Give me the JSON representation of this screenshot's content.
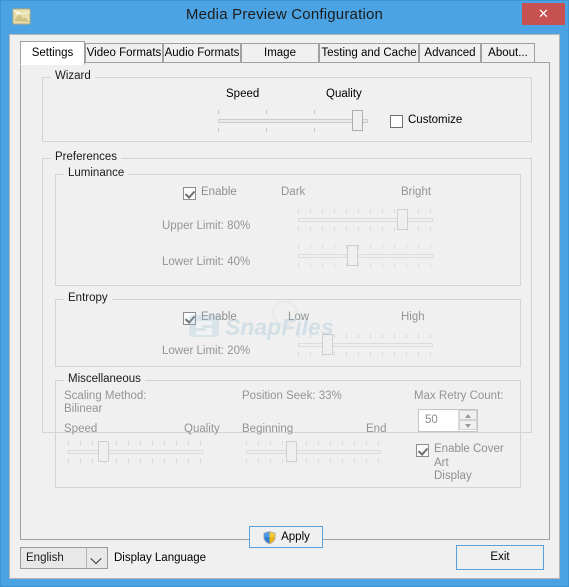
{
  "window": {
    "title": "Media Preview Configuration",
    "icon": "media-preview-app-icon",
    "close_label": "✕",
    "frame_color": "#4ba3e3",
    "close_color": "#c75050"
  },
  "tabs": [
    {
      "label": "Settings",
      "active": true
    },
    {
      "label": "Video Formats",
      "active": false
    },
    {
      "label": "Audio Formats",
      "active": false
    },
    {
      "label": "Image Formats",
      "active": false
    },
    {
      "label": "Testing and Cache",
      "active": false
    },
    {
      "label": "Advanced",
      "active": false
    },
    {
      "label": "About...",
      "active": false
    }
  ],
  "wizard": {
    "group_label": "Wizard",
    "left_label": "Speed",
    "right_label": "Quality",
    "slider_value_pct": 93,
    "customize": {
      "label": "Customize",
      "checked": false,
      "enabled": true
    }
  },
  "preferences": {
    "group_label": "Preferences",
    "luminance": {
      "group_label": "Luminance",
      "enable": {
        "label": "Enable",
        "checked": true,
        "enabled": false
      },
      "left_label": "Dark",
      "right_label": "Bright",
      "upper": {
        "label": "Upper Limit: 80%",
        "value_pct": 80
      },
      "lower": {
        "label": "Lower Limit: 40%",
        "value_pct": 40
      }
    },
    "entropy": {
      "group_label": "Entropy",
      "enable": {
        "label": "Enable",
        "checked": true,
        "enabled": false
      },
      "left_label": "Low",
      "right_label": "High",
      "lower": {
        "label": "Lower Limit: 20%",
        "value_pct": 20
      }
    },
    "miscellaneous": {
      "group_label": "Miscellaneous",
      "scaling_method_label": "Scaling Method:",
      "scaling_method_value": "Bilinear",
      "scaling_left_label": "Speed",
      "scaling_right_label": "Quality",
      "scaling_value_pct": 25,
      "position_seek_label": "Position Seek: 33%",
      "position_left_label": "Beginning",
      "position_right_label": "End",
      "position_value_pct": 33,
      "max_retry_label": "Max Retry Count:",
      "max_retry_value": "50",
      "cover_art": {
        "label_line1": "Enable Cover Art",
        "label_line2": "Display",
        "checked": true,
        "enabled": false
      }
    }
  },
  "apply": {
    "label": "Apply",
    "icon": "uac-shield-icon"
  },
  "footer": {
    "language_value": "English",
    "language_options": [
      "English"
    ],
    "language_caption": "Display Language",
    "exit_label": "Exit"
  },
  "watermark": {
    "text": "SnapFiles"
  }
}
